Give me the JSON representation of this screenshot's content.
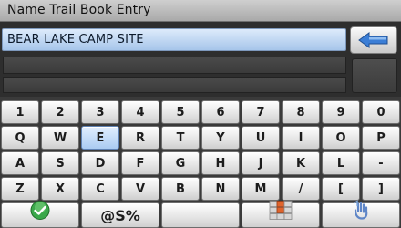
{
  "window": {
    "title": "Name Trail Book Entry"
  },
  "entry": {
    "value": "BEAR LAKE CAMP SITE"
  },
  "keyboard": {
    "rows": [
      [
        "1",
        "2",
        "3",
        "4",
        "5",
        "6",
        "7",
        "8",
        "9",
        "0"
      ],
      [
        "Q",
        "W",
        "E",
        "R",
        "T",
        "Y",
        "U",
        "I",
        "O",
        "P"
      ],
      [
        "A",
        "S",
        "D",
        "F",
        "G",
        "H",
        "J",
        "K",
        "L",
        "-"
      ],
      [
        "Z",
        "X",
        "C",
        "V",
        "B",
        "N",
        "M",
        "/",
        "[",
        "]"
      ]
    ],
    "selected_key": "E",
    "bottom": {
      "ok_icon": "green-check-icon",
      "symbols_label": "@S%",
      "layout_icon": "keyboard-layout-icon",
      "shift_icon": "shift-hand-icon"
    }
  },
  "colors": {
    "entry_fill": "#c6dbf5",
    "selected_key": "#c1daf6",
    "check_green": "#3aa84a",
    "layout_orange": "#e0642c"
  }
}
